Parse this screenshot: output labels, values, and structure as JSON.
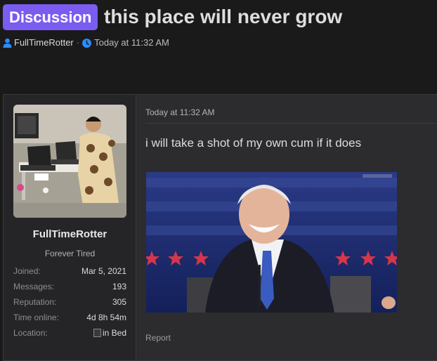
{
  "thread": {
    "prefix": "Discussion",
    "title": "this place will never grow",
    "author": "FullTimeRotter",
    "separator": "·",
    "time": "Today at 11:32 AM"
  },
  "colors": {
    "prefix_bg": "#7a5cf0",
    "meta_icon": "#2b8cff",
    "page_bg": "#1a1a1b",
    "post_bg": "#2c2c2e"
  },
  "user": {
    "name": "FullTimeRotter",
    "title": "Forever Tired",
    "stats": [
      {
        "label": "Joined:",
        "value": "Mar 5, 2021"
      },
      {
        "label": "Messages:",
        "value": "193"
      },
      {
        "label": "Reputation:",
        "value": "305"
      },
      {
        "label": "Time online:",
        "value": "4d 8h 54m"
      },
      {
        "label": "Location:",
        "value": "in Bed"
      }
    ]
  },
  "post": {
    "time": "Today at 11:32 AM",
    "body": "i will take a shot of my own cum if it does",
    "report_label": "Report"
  },
  "icons": {
    "author": "user-icon",
    "time": "clock-icon",
    "location": "broken-image-icon"
  }
}
